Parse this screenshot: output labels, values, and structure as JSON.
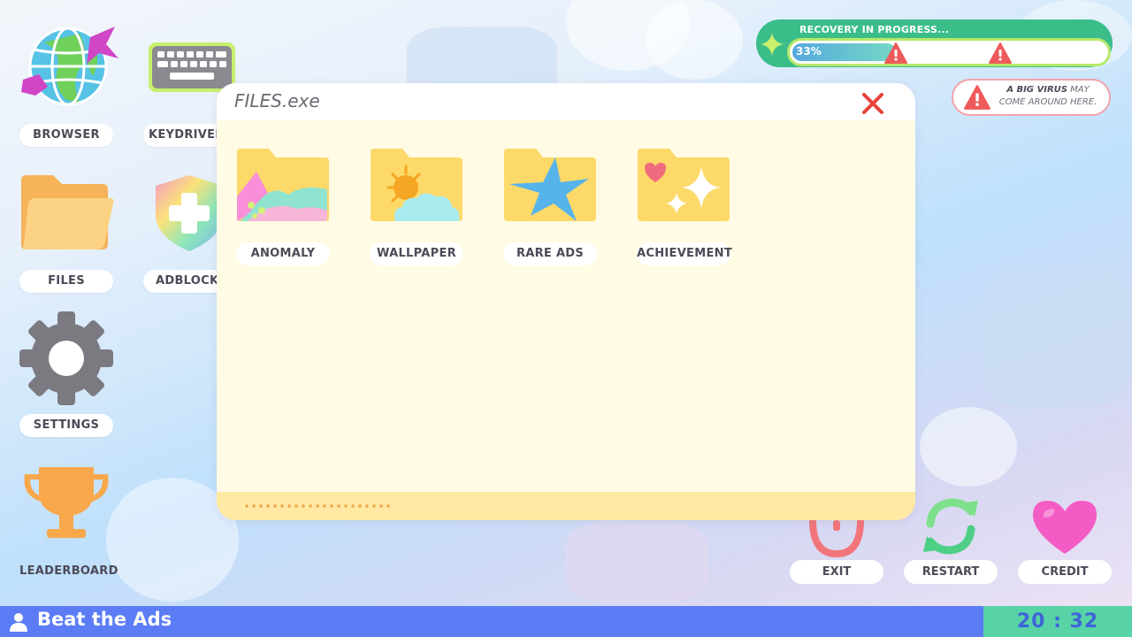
{
  "desktop": {
    "icons": [
      {
        "label": "BROWSER",
        "icon": "globe-icon"
      },
      {
        "label": "KEYDRIVER",
        "icon": "keyboard-icon"
      },
      {
        "label": "FILES",
        "icon": "folder-icon"
      },
      {
        "label": "ADBLOCKER",
        "icon": "shield-plus-icon"
      },
      {
        "label": "SETTINGS",
        "icon": "gear-icon"
      },
      {
        "label": "LEADERBOARD",
        "icon": "trophy-icon"
      }
    ]
  },
  "recovery": {
    "title": "RECOVERY IN PROGRESS...",
    "percent_label": "33%",
    "progress": 0.33,
    "warning_icons": [
      "warning-icon",
      "warning-icon"
    ]
  },
  "virus_notice": {
    "bold": "A BIG VIRUS",
    "rest": "MAY COME AROUND HERE."
  },
  "window": {
    "title": "FILES.exe",
    "folders": [
      {
        "label": "ANOMALY",
        "icon": "mountain-folder-icon"
      },
      {
        "label": "WALLPAPER",
        "icon": "sun-cloud-folder-icon"
      },
      {
        "label": "RARE ADS",
        "icon": "star-folder-icon"
      },
      {
        "label": "ACHIEVEMENT",
        "icon": "sparkle-heart-folder-icon"
      }
    ]
  },
  "actions": [
    {
      "label": "EXIT",
      "icon": "power-icon"
    },
    {
      "label": "RESTART",
      "icon": "restart-icon"
    },
    {
      "label": "CREDIT",
      "icon": "heart-icon"
    }
  ],
  "taskbar": {
    "title": "Beat the Ads",
    "clock": "20 : 32"
  },
  "colors": {
    "taskbar": "#5b7cf5",
    "clock_bg": "#58d3a6",
    "window_bg": "#fffbe4",
    "recovery_bg": "#3bbd8a",
    "close_red": "#e8413c"
  }
}
